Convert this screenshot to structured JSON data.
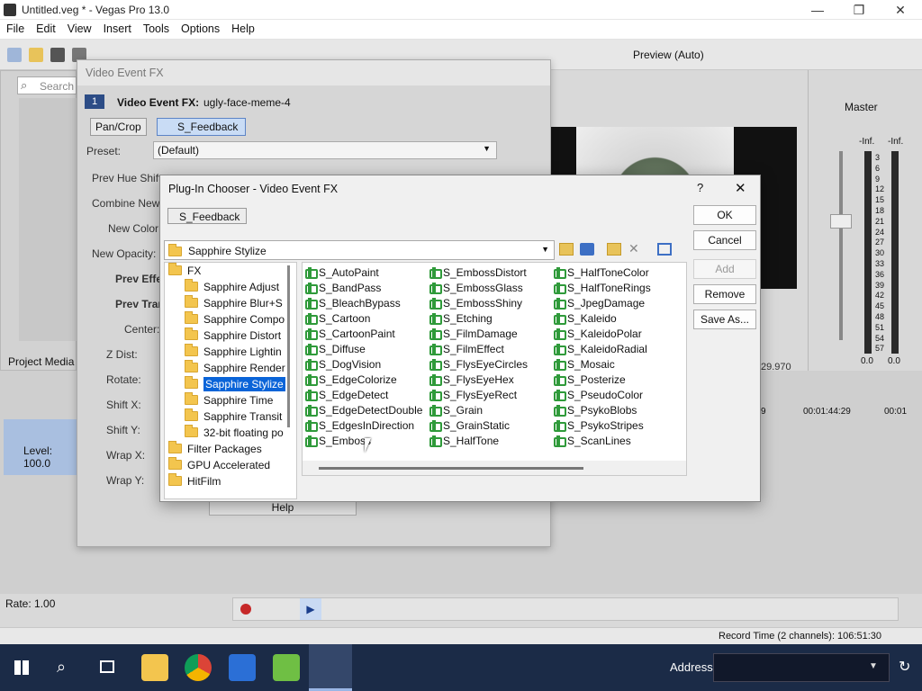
{
  "window": {
    "title": "Untitled.veg * - Vegas Pro 13.0",
    "minimize": "—",
    "maximize": "❐",
    "close": "✕"
  },
  "menu": [
    "File",
    "Edit",
    "View",
    "Insert",
    "Tools",
    "Options",
    "Help"
  ],
  "explorer": {
    "search_placeholder": "Search",
    "tab": "Project Media"
  },
  "preview": {
    "mode": "Preview (Auto)",
    "timecode": "29.970"
  },
  "mixer": {
    "title": "Master",
    "inf_left": "-Inf.",
    "inf_right": "-Inf.",
    "scale": [
      "3",
      "6",
      "9",
      "12",
      "15",
      "18",
      "21",
      "24",
      "27",
      "30",
      "33",
      "36",
      "39",
      "42",
      "45",
      "48",
      "51",
      "54",
      "57"
    ],
    "val_left": "0.0",
    "val_right": "0.0"
  },
  "vefx": {
    "window_title": "Video Event FX",
    "track_num": "1",
    "label": "Video Event FX:",
    "event_name": "ugly-face-meme-4",
    "chain": [
      "Pan/Crop",
      "S_Feedback"
    ],
    "preset_label": "Preset:",
    "preset_value": "(Default)",
    "params": [
      "Prev Hue Shift:",
      "Combine New:",
      "New Color:",
      "New Opacity:",
      "Prev Effe",
      "Prev Tran",
      "Center:",
      "Z Dist:",
      "Rotate:",
      "Shift X:",
      "Shift Y:",
      "Wrap X:",
      "Wrap Y:"
    ],
    "help": "Help"
  },
  "timeline": {
    "level": "Level: 100.0",
    "rate": "Rate: 1.00",
    "time_mark1": "9",
    "time_mark2": "00:01:44:29",
    "time_mark3": "00:01"
  },
  "status": {
    "record_time": "Record Time (2 channels): 106:51:30"
  },
  "dialog": {
    "title": "Plug-In Chooser - Video Event FX",
    "help_btn": "?",
    "close_btn": "✕",
    "chain_item": "S_Feedback",
    "path": "Sapphire Stylize",
    "buttons": {
      "ok": "OK",
      "cancel": "Cancel",
      "add": "Add",
      "remove": "Remove",
      "save_as": "Save As..."
    },
    "tree": [
      {
        "label": "FX",
        "level": 0,
        "selected": false
      },
      {
        "label": "Sapphire Adjust",
        "level": 1,
        "selected": false
      },
      {
        "label": "Sapphire Blur+S",
        "level": 1,
        "selected": false
      },
      {
        "label": "Sapphire Compo",
        "level": 1,
        "selected": false
      },
      {
        "label": "Sapphire Distort",
        "level": 1,
        "selected": false
      },
      {
        "label": "Sapphire Lightin",
        "level": 1,
        "selected": false
      },
      {
        "label": "Sapphire Render",
        "level": 1,
        "selected": false
      },
      {
        "label": "Sapphire Stylize",
        "level": 1,
        "selected": true
      },
      {
        "label": "Sapphire Time",
        "level": 1,
        "selected": false
      },
      {
        "label": "Sapphire Transit",
        "level": 1,
        "selected": false
      },
      {
        "label": "32-bit floating po",
        "level": 1,
        "selected": false
      },
      {
        "label": "Filter Packages",
        "level": 0,
        "selected": false
      },
      {
        "label": "GPU Accelerated",
        "level": 0,
        "selected": false
      },
      {
        "label": "HitFilm",
        "level": 0,
        "selected": false
      }
    ],
    "plugins_col1": [
      "S_AutoPaint",
      "S_BandPass",
      "S_BleachBypass",
      "S_Cartoon",
      "S_CartoonPaint",
      "S_Diffuse",
      "S_DogVision",
      "S_EdgeColorize",
      "S_EdgeDetect",
      "S_EdgeDetectDouble",
      "S_EdgesInDirection",
      "S_Emboss"
    ],
    "plugins_col2": [
      "S_EmbossDistort",
      "S_EmbossGlass",
      "S_EmbossShiny",
      "S_Etching",
      "S_FilmDamage",
      "S_FilmEffect",
      "S_FlysEyeCircles",
      "S_FlysEyeHex",
      "S_FlysEyeRect",
      "S_Grain",
      "S_GrainStatic",
      "S_HalfTone"
    ],
    "plugins_col3": [
      "S_HalfToneColor",
      "S_HalfToneRings",
      "S_JpegDamage",
      "S_Kaleido",
      "S_KaleidoPolar",
      "S_KaleidoRadial",
      "S_Mosaic",
      "S_Posterize",
      "S_PseudoColor",
      "S_PsykoBlobs",
      "S_PsykoStripes",
      "S_ScanLines"
    ]
  },
  "taskbar": {
    "address_label": "Address",
    "address_value": ""
  },
  "colors": {
    "accent": "#0a64d8",
    "taskbar": "#1b2b47",
    "plugin_icon": "#2f9a3a"
  }
}
